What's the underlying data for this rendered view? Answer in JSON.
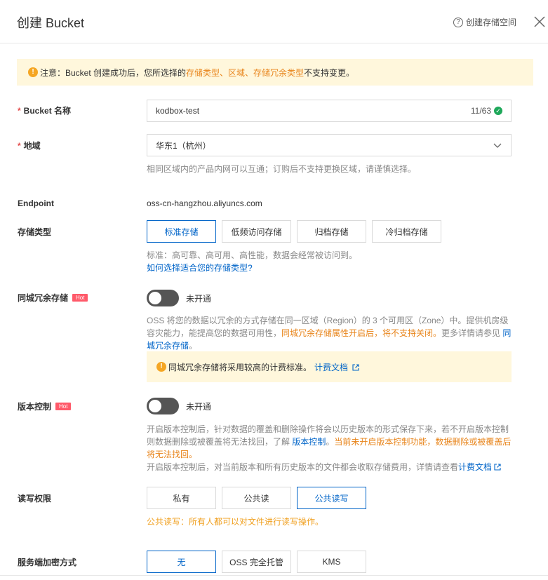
{
  "dialog": {
    "title": "创建 Bucket",
    "help_label": "创建存储空间"
  },
  "notice": {
    "prefix": "注意：Bucket 创建成功后，您所选择的 ",
    "highlight": "存储类型、区域、存储冗余类型",
    "suffix": " 不支持变更。"
  },
  "bucket_name": {
    "label": "Bucket 名称",
    "value": "kodbox-test",
    "counter": "11/63"
  },
  "region": {
    "label": "地域",
    "value": "华东1（杭州）",
    "help": "相同区域内的产品内网可以互通；订购后不支持更换区域，请谨慎选择。"
  },
  "endpoint": {
    "label": "Endpoint",
    "value": "oss-cn-hangzhou.aliyuncs.com"
  },
  "storage_class": {
    "label": "存储类型",
    "options": [
      "标准存储",
      "低频访问存储",
      "归档存储",
      "冷归档存储"
    ],
    "selected": "标准存储",
    "help": "标准：高可靠、高可用、高性能，数据会经常被访问到。",
    "link": "如何选择适合您的存储类型?"
  },
  "zrs": {
    "label": "同城冗余存储",
    "badge": "Hot",
    "state": "未开通",
    "help_line1": "OSS 将您的数据以冗余的方式存储在同一区域（Region）的 3 个可用区（Zone）中。提供机房级",
    "help_line2_a": "容灾能力，能提高您的数据可用性，",
    "help_line2_orange": "同城冗余存储属性开启后，将不支持关闭。",
    "help_line2_b": "更多详情请参见 ",
    "help_line2_link": "同",
    "help_line3_link": "城冗余存储",
    "help_line3_end": "。",
    "tip": "同城冗余存储将采用较高的计费标准。",
    "tip_link": "计费文档"
  },
  "versioning": {
    "label": "版本控制",
    "badge": "Hot",
    "state": "未开通",
    "help_line1": "开启版本控制后，针对数据的覆盖和删除操作将会以历史版本的形式保存下来，若不开启版本控制",
    "help_line2_a": "则数据删除或被覆盖将无法找回，了解 ",
    "help_line2_link": "版本控制",
    "help_line2_b": "。",
    "help_line2_orange": "当前未开启版本控制功能，数据删除或被覆盖后",
    "help_line3_orange": "将无法找回。",
    "help_line4": "开启版本控制后，对当前版本和所有历史版本的文件都会收取存储费用，详情请查看",
    "help_line4_link": "计费文档"
  },
  "acl": {
    "label": "读写权限",
    "options": [
      "私有",
      "公共读",
      "公共读写"
    ],
    "selected": "公共读写",
    "warning": "公共读写：所有人都可以对文件进行读写操作。"
  },
  "encryption": {
    "label": "服务端加密方式",
    "options": [
      "无",
      "OSS 完全托管",
      "KMS"
    ],
    "selected": "无"
  },
  "colors": {
    "accent": "#0064c8",
    "warning": "#e8841a",
    "notice_bg": "#fff7dc",
    "hot_badge": "#ff5a6a",
    "success": "#1ea85a"
  }
}
